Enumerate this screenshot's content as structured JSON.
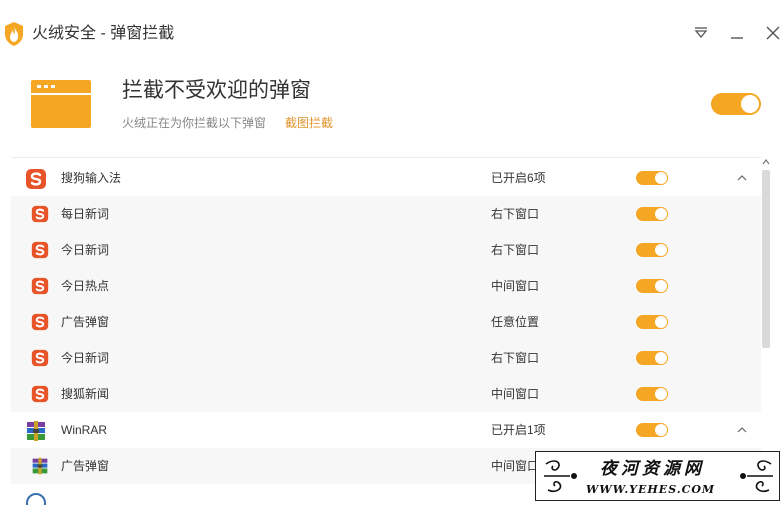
{
  "window": {
    "title": "火绒安全 - 弹窗拦截",
    "icons": {
      "logo": "huorong-shield-icon",
      "menu": "dropdown-menu-icon",
      "minimize": "minimize-icon",
      "close": "close-icon"
    }
  },
  "header": {
    "title": "拦截不受欢迎的弹窗",
    "subtitle": "火绒正在为你拦截以下弹窗",
    "link": "截图拦截",
    "icon": "popup-window-icon",
    "enabled": true
  },
  "colors": {
    "accent": "#f5a623",
    "link": "#e0952a",
    "sogou": "#e8542a",
    "child_bg": "#f7f7f7"
  },
  "rows": [
    {
      "kind": "group",
      "icon": "sogou-icon",
      "name": "搜狗输入法",
      "status": "已开启6项",
      "enabled": true,
      "expanded": true
    },
    {
      "kind": "child",
      "icon": "sogou-icon",
      "name": "每日新词",
      "status": "右下窗口",
      "enabled": true
    },
    {
      "kind": "child",
      "icon": "sogou-icon",
      "name": "今日新词",
      "status": "右下窗口",
      "enabled": true
    },
    {
      "kind": "child",
      "icon": "sogou-icon",
      "name": "今日热点",
      "status": "中间窗口",
      "enabled": true
    },
    {
      "kind": "child",
      "icon": "sogou-icon",
      "name": "广告弹窗",
      "status": "任意位置",
      "enabled": true
    },
    {
      "kind": "child",
      "icon": "sogou-icon",
      "name": "今日新词",
      "status": "右下窗口",
      "enabled": true
    },
    {
      "kind": "child",
      "icon": "sogou-icon",
      "name": "搜狐新闻",
      "status": "中间窗口",
      "enabled": true
    },
    {
      "kind": "group",
      "icon": "winrar-icon",
      "name": "WinRAR",
      "status": "已开启1项",
      "enabled": true,
      "expanded": true
    },
    {
      "kind": "child",
      "icon": "winrar-icon",
      "name": "广告弹窗",
      "status": "中间窗口",
      "enabled": true
    },
    {
      "kind": "group",
      "icon": "app-icon",
      "name": "",
      "status": "",
      "enabled": true,
      "expanded": false
    }
  ],
  "watermark": {
    "title": "夜河资源网",
    "url": "WWW.YEHES.COM"
  }
}
